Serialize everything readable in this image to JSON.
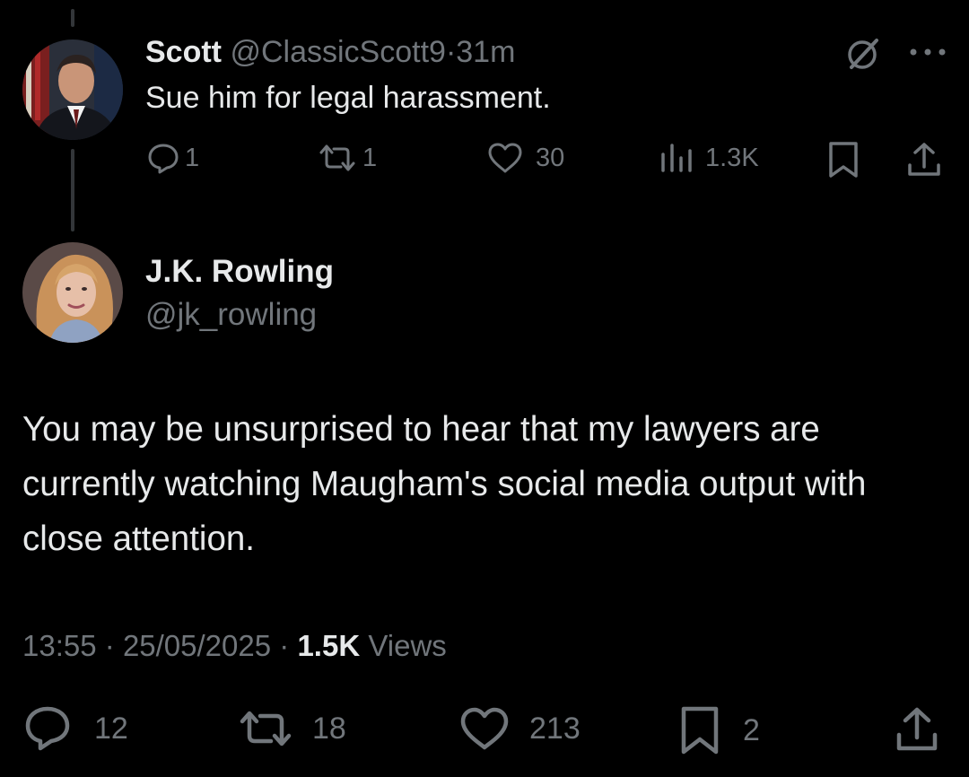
{
  "reply": {
    "name": "Scott",
    "handle": "@ClassicScott9",
    "separator": "·",
    "time": "31m",
    "text": "Sue him for legal harassment.",
    "metrics": {
      "replies": "1",
      "reposts": "1",
      "likes": "30",
      "views": "1.3K"
    },
    "icons": [
      "grok-icon",
      "more-icon",
      "reply-icon",
      "repost-icon",
      "like-icon",
      "views-icon",
      "bookmark-icon",
      "share-icon"
    ]
  },
  "main": {
    "name": "J.K. Rowling",
    "handle": "@jk_rowling",
    "text": "You may be unsurprised to hear that my lawyers are currently watching Maugham's social media output with close attention.",
    "time": "13:55",
    "sep1": "·",
    "date": "25/05/2025",
    "sep2": "·",
    "views_count": "1.5K",
    "views_label": "Views",
    "metrics": {
      "replies": "12",
      "reposts": "18",
      "likes": "213",
      "bookmarks": "2"
    }
  },
  "colors": {
    "background": "#000000",
    "text": "#e7e9ea",
    "muted": "#71767b",
    "thread_line": "#333639"
  }
}
